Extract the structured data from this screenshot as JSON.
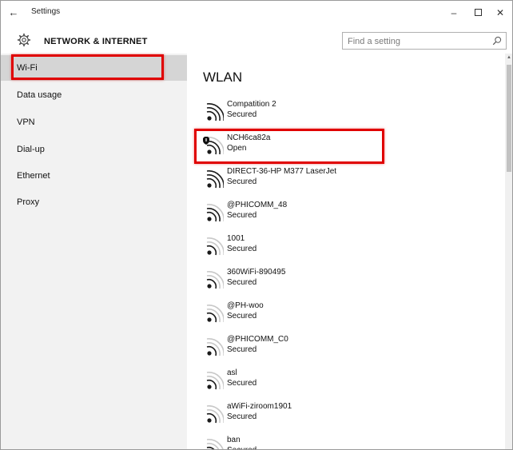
{
  "window": {
    "title": "Settings",
    "back_glyph": "←",
    "minimize_glyph": "–",
    "close_glyph": "✕"
  },
  "header": {
    "title": "NETWORK & INTERNET",
    "icon": "gear-icon"
  },
  "search": {
    "placeholder": "Find a setting",
    "icon": "search-icon"
  },
  "sidebar": {
    "items": [
      {
        "label": "Wi-Fi",
        "selected": true
      },
      {
        "label": "Data usage",
        "selected": false
      },
      {
        "label": "VPN",
        "selected": false
      },
      {
        "label": "Dial-up",
        "selected": false
      },
      {
        "label": "Ethernet",
        "selected": false
      },
      {
        "label": "Proxy",
        "selected": false
      }
    ]
  },
  "main": {
    "title": "WLAN",
    "networks": [
      {
        "ssid": "Compatition 2",
        "status": "Secured",
        "strength": 4,
        "warning": false
      },
      {
        "ssid": "NCH6ca82a",
        "status": "Open",
        "strength": 3,
        "warning": true
      },
      {
        "ssid": "DIRECT-36-HP M377 LaserJet",
        "status": "Secured",
        "strength": 4,
        "warning": false
      },
      {
        "ssid": "@PHICOMM_48",
        "status": "Secured",
        "strength": 3,
        "warning": false
      },
      {
        "ssid": "1001",
        "status": "Secured",
        "strength": 2,
        "warning": false
      },
      {
        "ssid": "360WiFi-890495",
        "status": "Secured",
        "strength": 2,
        "warning": false
      },
      {
        "ssid": "@PH-woo",
        "status": "Secured",
        "strength": 2,
        "warning": false
      },
      {
        "ssid": "@PHICOMM_C0",
        "status": "Secured",
        "strength": 2,
        "warning": false
      },
      {
        "ssid": "asl",
        "status": "Secured",
        "strength": 2,
        "warning": false
      },
      {
        "ssid": "aWiFi-ziroom1901",
        "status": "Secured",
        "strength": 2,
        "warning": false
      },
      {
        "ssid": "ban",
        "status": "Secured",
        "strength": 2,
        "warning": false
      }
    ]
  },
  "colors": {
    "highlight": "#e00000",
    "sidebar_bg": "#f2f2f2",
    "sidebar_selected": "#d5d5d5",
    "wifi_active": "#1a1a1a",
    "wifi_inactive": "#c8c8c8"
  }
}
